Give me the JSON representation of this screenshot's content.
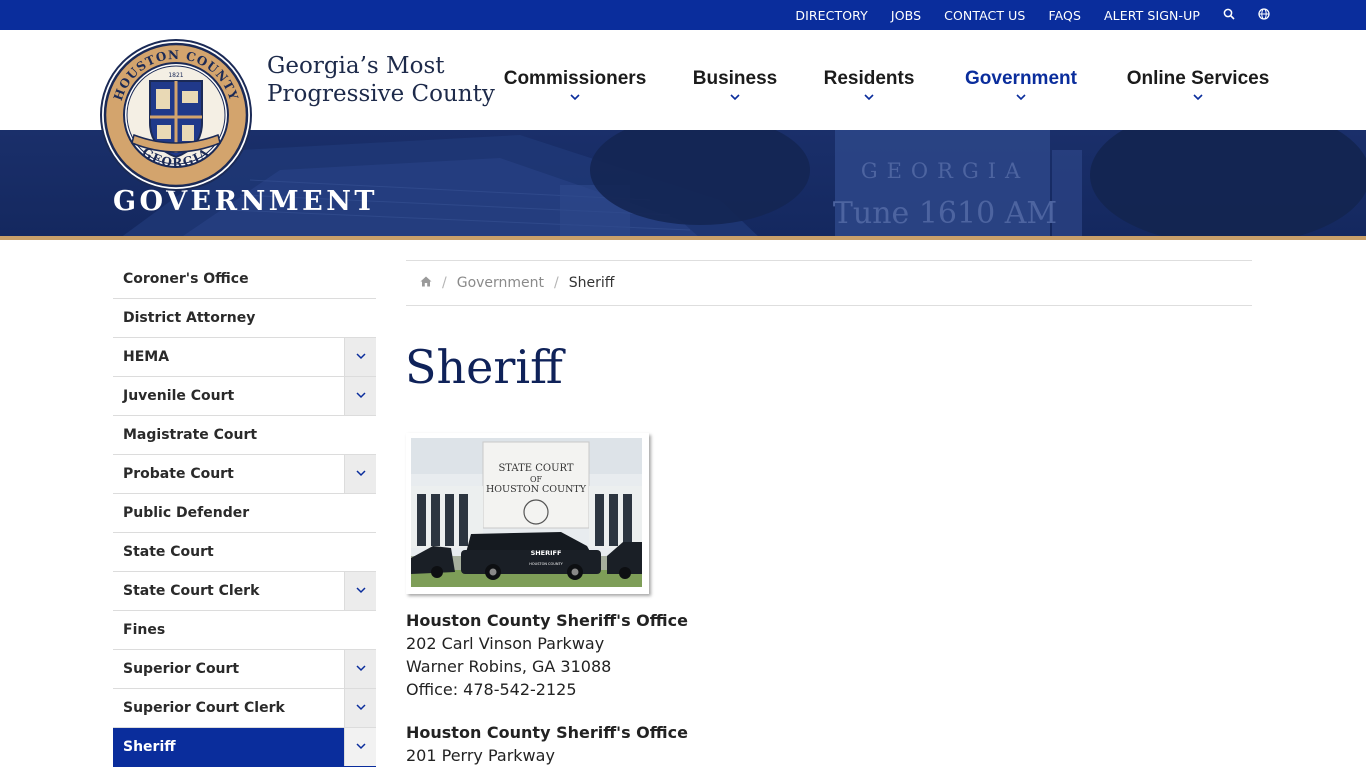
{
  "topbar": {
    "links": [
      "DIRECTORY",
      "JOBS",
      "CONTACT US",
      "FAQS",
      "ALERT SIGN-UP"
    ],
    "icons": [
      "search-icon",
      "translate-icon"
    ]
  },
  "header": {
    "seal_text_top": "HOUSTON COUNTY",
    "seal_text_bottom": "GEORGIA",
    "seal_year": "1821",
    "logo_line1": "Georgia’s Most",
    "logo_line2": "Progressive County",
    "nav": [
      {
        "label": "Commissioners"
      },
      {
        "label": "Business"
      },
      {
        "label": "Residents"
      },
      {
        "label": "Government",
        "active": true
      },
      {
        "label": "Online Services"
      }
    ]
  },
  "hero": {
    "title": "GOVERNMENT",
    "sign_line1": "GEORGIA",
    "sign_line2": "Tune 1610 AM"
  },
  "sidebar": {
    "items": [
      {
        "label": "Coroner's Office",
        "toggle": false
      },
      {
        "label": "District Attorney",
        "toggle": false
      },
      {
        "label": "HEMA",
        "toggle": true
      },
      {
        "label": "Juvenile Court",
        "toggle": true
      },
      {
        "label": "Magistrate Court",
        "toggle": false
      },
      {
        "label": "Probate Court",
        "toggle": true
      },
      {
        "label": "Public Defender",
        "toggle": false
      },
      {
        "label": "State Court",
        "toggle": false
      },
      {
        "label": "State Court Clerk",
        "toggle": true
      },
      {
        "label": "Fines",
        "toggle": false
      },
      {
        "label": "Superior Court",
        "toggle": true
      },
      {
        "label": "Superior Court Clerk",
        "toggle": true
      },
      {
        "label": "Sheriff",
        "toggle": true,
        "active": true
      }
    ]
  },
  "breadcrumb": {
    "parent": "Government",
    "current": "Sheriff"
  },
  "main": {
    "title": "Sheriff",
    "photo": {
      "sign_line1": "STATE COURT",
      "sign_line2": "OF",
      "sign_line3": "HOUSTON COUNTY",
      "vehicle_text": "SHERIFF",
      "vehicle_subtext": "HOUSTON COUNTY"
    },
    "addresses": [
      {
        "name": "Houston County Sheriff's Office",
        "line1": "202 Carl Vinson Parkway",
        "line2": "Warner Robins, GA 31088",
        "line3": "Office: 478-542-2125"
      },
      {
        "name": "Houston County Sheriff's Office",
        "line1": "201 Perry Parkway"
      }
    ]
  },
  "colors": {
    "brand_blue": "#0a2d9c",
    "navy": "#0f2259",
    "gold": "#c9a06a"
  }
}
